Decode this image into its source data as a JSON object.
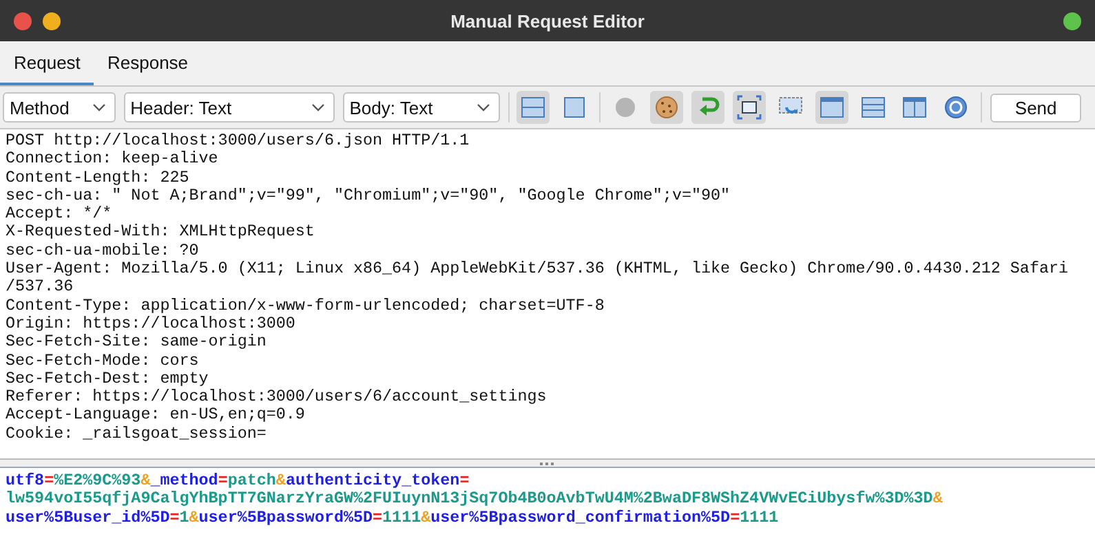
{
  "window": {
    "title": "Manual Request Editor"
  },
  "tabs": [
    {
      "label": "Request",
      "selected": true
    },
    {
      "label": "Response",
      "selected": false
    }
  ],
  "toolbar": {
    "selects": [
      {
        "value": "Method",
        "kind": "narrow"
      },
      {
        "value": "Header: Text",
        "kind": "wide"
      },
      {
        "value": "Body: Text",
        "kind": "medium"
      }
    ],
    "buttons": [
      {
        "kind": "split-horizontal",
        "selected": true
      },
      {
        "kind": "single-pane",
        "selected": false
      },
      {
        "kind": "separator"
      },
      {
        "kind": "disabled-circle",
        "selected": false
      },
      {
        "kind": "cookie",
        "selected": true
      },
      {
        "kind": "return-arrow",
        "selected": true
      },
      {
        "kind": "fullscreen",
        "selected": true
      },
      {
        "kind": "refresh-window",
        "selected": false
      },
      {
        "kind": "tab-window",
        "selected": true
      },
      {
        "kind": "rows-layout",
        "selected": false
      },
      {
        "kind": "columns-layout",
        "selected": false
      },
      {
        "kind": "help",
        "selected": false
      }
    ],
    "send": "Send"
  },
  "header_lines": [
    "POST http://localhost:3000/users/6.json HTTP/1.1",
    "Connection: keep-alive",
    "Content-Length: 225",
    "sec-ch-ua: \" Not A;Brand\";v=\"99\", \"Chromium\";v=\"90\", \"Google Chrome\";v=\"90\"",
    "Accept: */*",
    "X-Requested-With: XMLHttpRequest",
    "sec-ch-ua-mobile: ?0",
    "User-Agent: Mozilla/5.0 (X11; Linux x86_64) AppleWebKit/537.36 (KHTML, like Gecko) Chrome/90.0.4430.212 Safari",
    "/537.36",
    "Content-Type: application/x-www-form-urlencoded; charset=UTF-8",
    "Origin: https://localhost:3000",
    "Sec-Fetch-Site: same-origin",
    "Sec-Fetch-Mode: cors",
    "Sec-Fetch-Dest: empty",
    "Referer: https://localhost:3000/users/6/account_settings",
    "Accept-Language: en-US,en;q=0.9",
    "Cookie: _railsgoat_session="
  ],
  "body_lines": [
    [
      {
        "kind": "key",
        "text": "utf8"
      },
      {
        "kind": "eq",
        "text": "="
      },
      {
        "kind": "value",
        "text": "%E2%9C%93"
      },
      {
        "kind": "amp",
        "text": "&"
      },
      {
        "kind": "key",
        "text": "_method"
      },
      {
        "kind": "eq",
        "text": "="
      },
      {
        "kind": "value",
        "text": "patch"
      },
      {
        "kind": "amp",
        "text": "&"
      },
      {
        "kind": "key",
        "text": "authenticity_token"
      },
      {
        "kind": "eq",
        "text": "="
      }
    ],
    [
      {
        "kind": "value",
        "text": "lw594voI55qfjA9CalgYhBpTT7GNarzYraGW%2FUIuynN13jSq7Ob4B0oAvbTwU4M%2BwaDF8WShZ4VWvECiUbysfw%3D%3D"
      },
      {
        "kind": "amp",
        "text": "&"
      }
    ],
    [
      {
        "kind": "key",
        "text": "user%5Buser_id%5D"
      },
      {
        "kind": "eq",
        "text": "="
      },
      {
        "kind": "value",
        "text": "1"
      },
      {
        "kind": "amp",
        "text": "&"
      },
      {
        "kind": "key",
        "text": "user%5Bpassword%5D"
      },
      {
        "kind": "eq",
        "text": "="
      },
      {
        "kind": "value",
        "text": "1111"
      },
      {
        "kind": "amp",
        "text": "&"
      },
      {
        "kind": "key",
        "text": "user%5Bpassword_confirmation%5D"
      },
      {
        "kind": "eq",
        "text": "="
      },
      {
        "kind": "value",
        "text": "1111"
      }
    ]
  ]
}
